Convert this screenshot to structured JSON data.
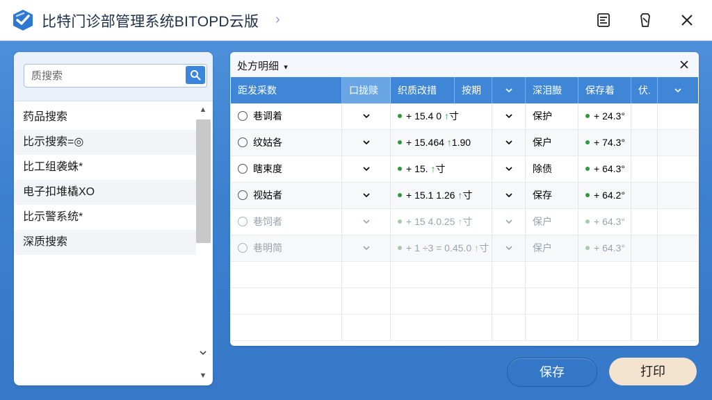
{
  "window": {
    "title": "比特门诊部管理系统BITOPD云版",
    "title_chevron": "›"
  },
  "titlebar_icons": [
    "receipt-icon",
    "clip-icon",
    "close-icon"
  ],
  "left_panel": {
    "search": {
      "placeholder": "质搜索",
      "value": ""
    },
    "items": [
      {
        "label": "药品搜索"
      },
      {
        "label": "比示搜索=◎"
      },
      {
        "label": "比工组袭蛛*"
      },
      {
        "label": "电子扣堆橇XO"
      },
      {
        "label": "比示警系统*"
      },
      {
        "label": "深质搜索"
      }
    ]
  },
  "right_panel": {
    "title": "处方明细",
    "title_caret": "▾",
    "columns": [
      "距发采数",
      "口拢赎",
      "",
      "织质改措",
      "按期",
      "",
      "深泪臌",
      "保存着",
      "伏."
    ],
    "rows": [
      {
        "name": "巷调着",
        "value": "15.4 0",
        "arrow_text": "寸",
        "status": "保护",
        "stock": "24.3°",
        "faded": false
      },
      {
        "name": "纹姑各",
        "value": "15.464",
        "arrow_text": "1.90",
        "status": "保户",
        "stock": "74.3°",
        "faded": false
      },
      {
        "name": "瞎束度",
        "value": "15.",
        "arrow_text": "寸",
        "status": "除债",
        "stock": "64.3°",
        "faded": false
      },
      {
        "name": "视姑者",
        "value": "15.1 1.26",
        "arrow_text": "寸",
        "status": "保存",
        "stock": "64.2°",
        "faded": false
      },
      {
        "name": "巷饲者",
        "value": "15 4.0.25",
        "arrow_text": "寸",
        "status": "保户",
        "stock": "64.3°",
        "faded": true
      },
      {
        "name": "巷明简",
        "value": "1 ÷3 = 0.45.0",
        "arrow_text": "寸",
        "status": "保户",
        "stock": "64.3°",
        "faded": true
      }
    ]
  },
  "buttons": {
    "save": "保存",
    "print": "打印"
  },
  "colors": {
    "accent": "#3f87d6",
    "desktop": "#3a7fce",
    "print_button": "#f3e3cf",
    "status_green": "#2e9a3e"
  }
}
